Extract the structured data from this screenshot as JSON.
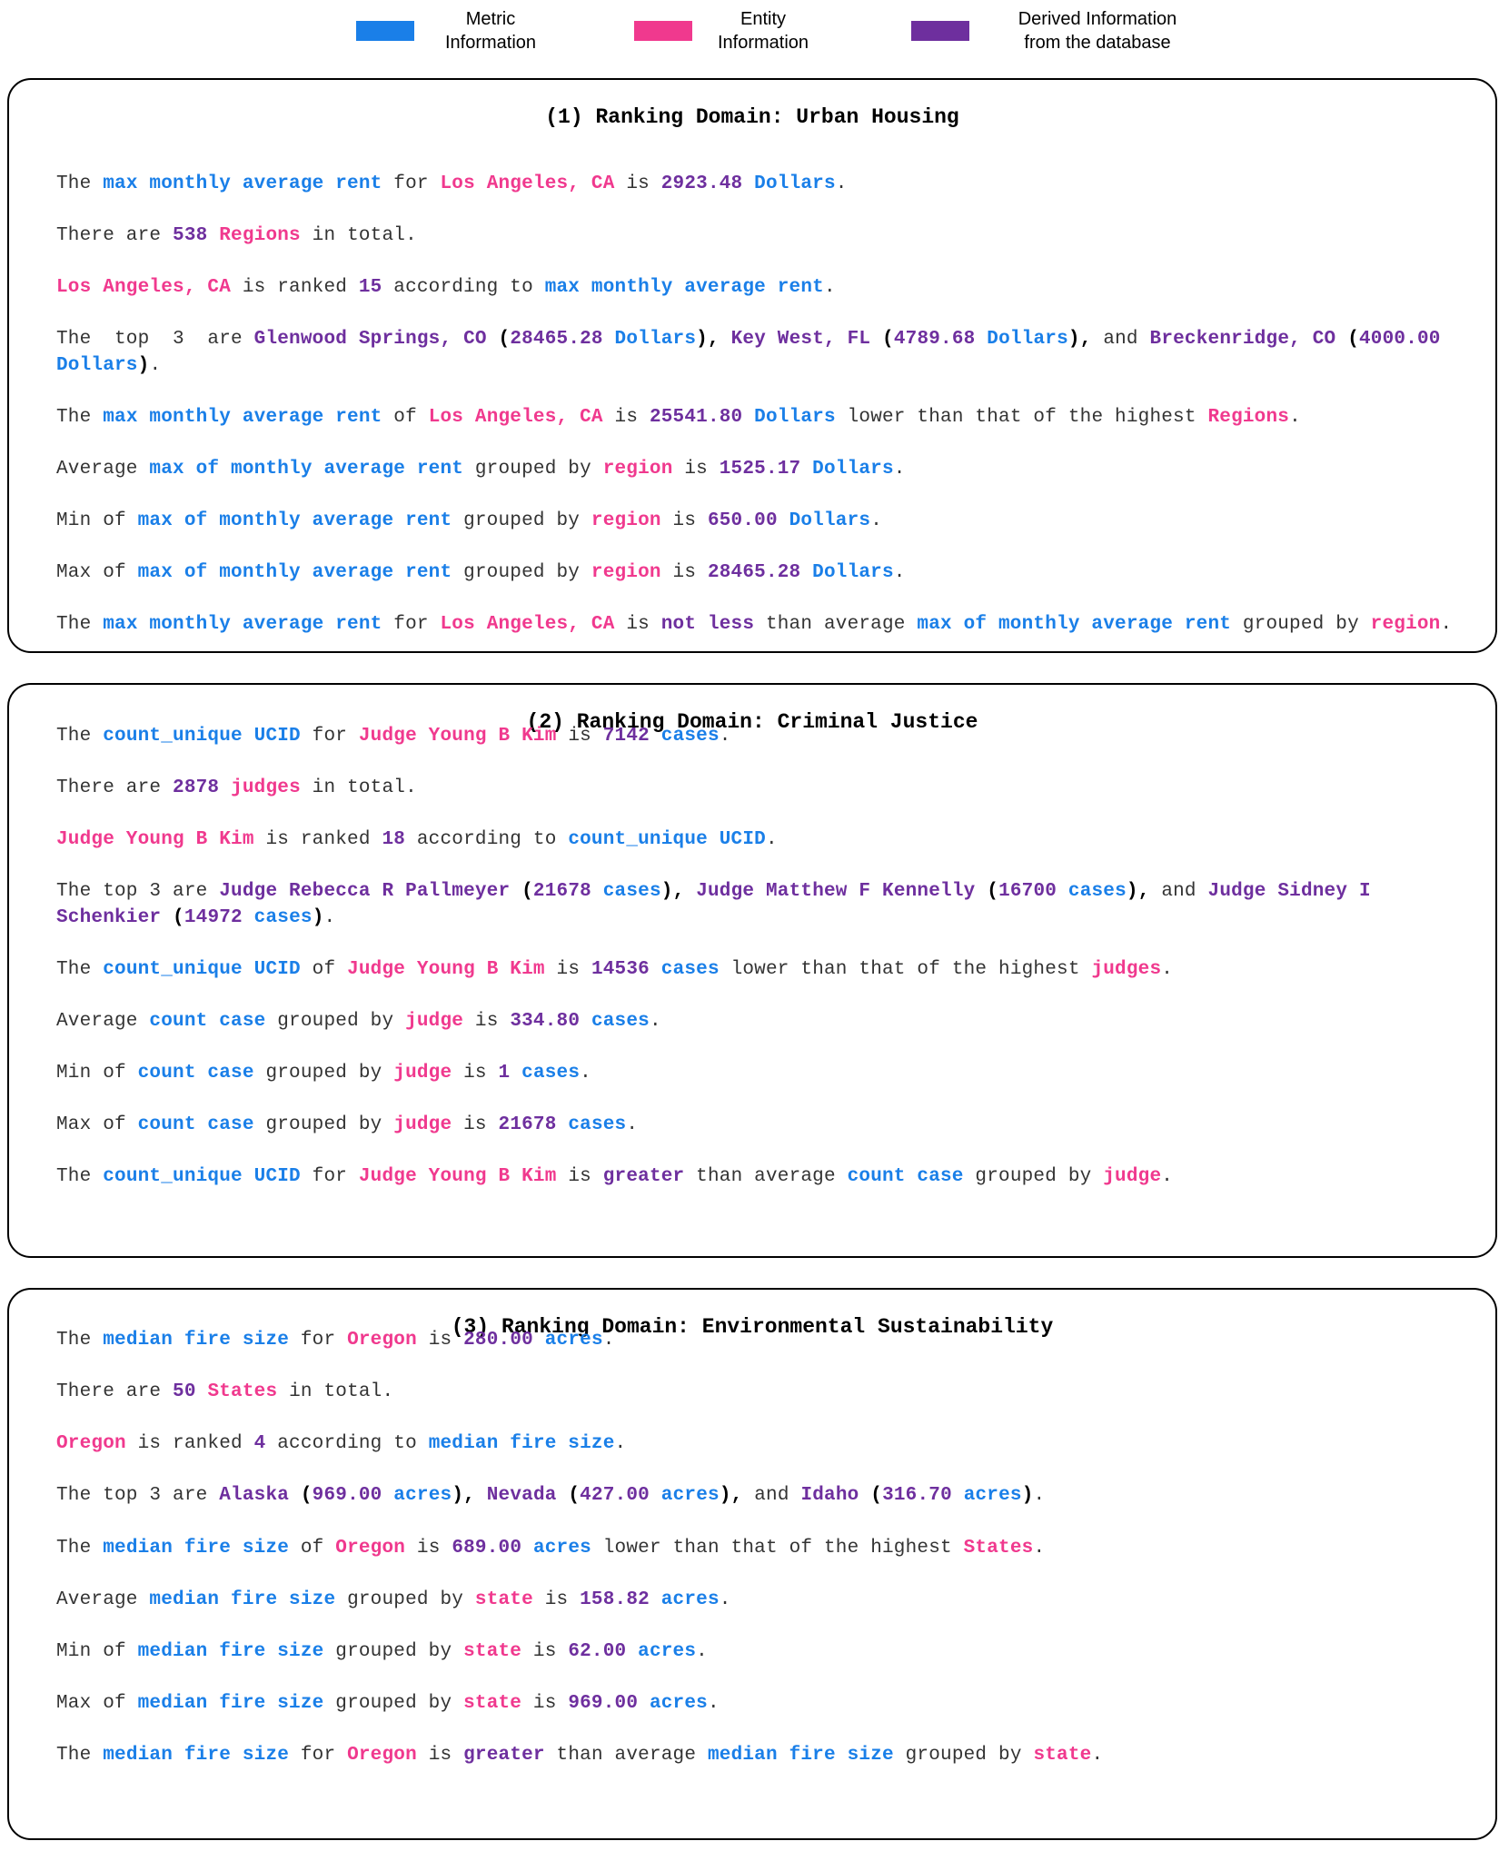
{
  "colors": {
    "metric": "#1A7FE8",
    "entity": "#F0398E",
    "derived": "#6E2F9E",
    "text": "#333333",
    "border": "#000000"
  },
  "legend": [
    {
      "label_line1": "Metric",
      "label_line2": "Information",
      "color": "#1A7FE8"
    },
    {
      "label_line1": "Entity",
      "label_line2": "Information",
      "color": "#F0398E"
    },
    {
      "label_line1": "Derived Information",
      "label_line2": "from the database",
      "color": "#6E2F9E"
    }
  ],
  "panels": [
    {
      "title": "(1) Ranking Domain: Urban Housing",
      "lines": [
        [
          [
            "t",
            "The "
          ],
          [
            "m",
            "max monthly average rent"
          ],
          [
            "t",
            " for "
          ],
          [
            "e",
            "Los Angeles, CA"
          ],
          [
            "t",
            " is "
          ],
          [
            "d",
            "2923.48"
          ],
          [
            "t",
            " "
          ],
          [
            "m",
            "Dollars"
          ],
          [
            "t",
            "."
          ]
        ],
        [
          [
            "t",
            "There are "
          ],
          [
            "d",
            "538"
          ],
          [
            "t",
            " "
          ],
          [
            "e",
            "Regions"
          ],
          [
            "t",
            " in total."
          ]
        ],
        [
          [
            "e",
            "Los Angeles, CA"
          ],
          [
            "t",
            " is ranked "
          ],
          [
            "d",
            "15"
          ],
          [
            "t",
            " according to "
          ],
          [
            "m",
            "max monthly average rent"
          ],
          [
            "t",
            "."
          ]
        ],
        [
          [
            "t",
            "The  top  3  are "
          ],
          [
            "d",
            "Glenwood Springs, CO"
          ],
          [
            "t",
            " "
          ],
          [
            "s",
            "("
          ],
          [
            "d",
            "28465.28"
          ],
          [
            "t",
            " "
          ],
          [
            "m",
            "Dollars"
          ],
          [
            "s",
            "),"
          ],
          [
            "t",
            " "
          ],
          [
            "d",
            "Key West, FL"
          ],
          [
            "t",
            " "
          ],
          [
            "s",
            "("
          ],
          [
            "d",
            "4789.68"
          ],
          [
            "t",
            " "
          ],
          [
            "m",
            "Dollars"
          ],
          [
            "s",
            "),"
          ],
          [
            "t",
            " and "
          ],
          [
            "d",
            "Breckenridge, CO"
          ],
          [
            "t",
            " "
          ],
          [
            "s",
            "("
          ],
          [
            "d",
            "4000.00"
          ],
          [
            "t",
            " "
          ],
          [
            "m",
            "Dollars"
          ],
          [
            "s",
            ")"
          ],
          [
            "t",
            "."
          ]
        ],
        [
          [
            "t",
            "The "
          ],
          [
            "m",
            "max monthly average rent"
          ],
          [
            "t",
            " of "
          ],
          [
            "e",
            "Los Angeles, CA"
          ],
          [
            "t",
            " is "
          ],
          [
            "d",
            "25541.80"
          ],
          [
            "t",
            " "
          ],
          [
            "m",
            "Dollars"
          ],
          [
            "t",
            " lower than that of the highest "
          ],
          [
            "e",
            "Regions"
          ],
          [
            "t",
            "."
          ]
        ],
        [
          [
            "t",
            "Average "
          ],
          [
            "m",
            "max of monthly average rent"
          ],
          [
            "t",
            " grouped by "
          ],
          [
            "e",
            "region"
          ],
          [
            "t",
            " is "
          ],
          [
            "d",
            "1525.17"
          ],
          [
            "t",
            " "
          ],
          [
            "m",
            "Dollars"
          ],
          [
            "t",
            "."
          ]
        ],
        [
          [
            "t",
            "Min of "
          ],
          [
            "m",
            "max of monthly average rent"
          ],
          [
            "t",
            " grouped by "
          ],
          [
            "e",
            "region"
          ],
          [
            "t",
            " is "
          ],
          [
            "d",
            "650.00"
          ],
          [
            "t",
            " "
          ],
          [
            "m",
            "Dollars"
          ],
          [
            "t",
            "."
          ]
        ],
        [
          [
            "t",
            "Max of "
          ],
          [
            "m",
            "max of monthly average rent"
          ],
          [
            "t",
            " grouped by "
          ],
          [
            "e",
            "region"
          ],
          [
            "t",
            " is "
          ],
          [
            "d",
            "28465.28"
          ],
          [
            "t",
            " "
          ],
          [
            "m",
            "Dollars"
          ],
          [
            "t",
            "."
          ]
        ],
        [
          [
            "t",
            "The "
          ],
          [
            "m",
            "max monthly average rent"
          ],
          [
            "t",
            " for "
          ],
          [
            "e",
            "Los Angeles, CA"
          ],
          [
            "t",
            " is "
          ],
          [
            "d",
            "not less"
          ],
          [
            "t",
            " than average "
          ],
          [
            "m",
            "max of monthly average rent"
          ],
          [
            "t",
            " grouped by "
          ],
          [
            "e",
            "region"
          ],
          [
            "t",
            "."
          ]
        ]
      ]
    },
    {
      "title": "(2) Ranking Domain: Criminal Justice",
      "lines": [
        [
          [
            "t",
            "The "
          ],
          [
            "m",
            "count_unique UCID"
          ],
          [
            "t",
            " for "
          ],
          [
            "e",
            "Judge Young B Kim"
          ],
          [
            "t",
            " is "
          ],
          [
            "d",
            "7142"
          ],
          [
            "t",
            " "
          ],
          [
            "m",
            "cases"
          ],
          [
            "t",
            "."
          ]
        ],
        [
          [
            "t",
            "There are "
          ],
          [
            "d",
            "2878"
          ],
          [
            "t",
            " "
          ],
          [
            "e",
            "judges"
          ],
          [
            "t",
            " in total."
          ]
        ],
        [
          [
            "e",
            "Judge Young B Kim"
          ],
          [
            "t",
            " is ranked "
          ],
          [
            "d",
            "18"
          ],
          [
            "t",
            " according to "
          ],
          [
            "m",
            "count_unique UCID"
          ],
          [
            "t",
            "."
          ]
        ],
        [
          [
            "t",
            "The top 3 are "
          ],
          [
            "d",
            "Judge Rebecca R Pallmeyer"
          ],
          [
            "t",
            " "
          ],
          [
            "s",
            "("
          ],
          [
            "d",
            "21678"
          ],
          [
            "t",
            " "
          ],
          [
            "m",
            "cases"
          ],
          [
            "s",
            "),"
          ],
          [
            "t",
            " "
          ],
          [
            "d",
            "Judge Matthew F Kennelly"
          ],
          [
            "t",
            " "
          ],
          [
            "s",
            "("
          ],
          [
            "d",
            "16700"
          ],
          [
            "t",
            " "
          ],
          [
            "m",
            "cases"
          ],
          [
            "s",
            "),"
          ],
          [
            "t",
            " and "
          ],
          [
            "d",
            "Judge Sidney I Schenkier"
          ],
          [
            "t",
            " "
          ],
          [
            "s",
            "("
          ],
          [
            "d",
            "14972"
          ],
          [
            "t",
            " "
          ],
          [
            "m",
            "cases"
          ],
          [
            "s",
            ")"
          ],
          [
            "t",
            "."
          ]
        ],
        [
          [
            "t",
            "The "
          ],
          [
            "m",
            "count_unique UCID"
          ],
          [
            "t",
            " of "
          ],
          [
            "e",
            "Judge Young B Kim"
          ],
          [
            "t",
            " is "
          ],
          [
            "d",
            "14536"
          ],
          [
            "t",
            " "
          ],
          [
            "m",
            "cases"
          ],
          [
            "t",
            " lower than that of the highest "
          ],
          [
            "e",
            "judges"
          ],
          [
            "t",
            "."
          ]
        ],
        [
          [
            "t",
            "Average "
          ],
          [
            "m",
            "count case"
          ],
          [
            "t",
            " grouped by "
          ],
          [
            "e",
            "judge"
          ],
          [
            "t",
            " is "
          ],
          [
            "d",
            "334.80"
          ],
          [
            "t",
            " "
          ],
          [
            "m",
            "cases"
          ],
          [
            "t",
            "."
          ]
        ],
        [
          [
            "t",
            "Min of "
          ],
          [
            "m",
            "count case"
          ],
          [
            "t",
            " grouped by "
          ],
          [
            "e",
            "judge"
          ],
          [
            "t",
            " is "
          ],
          [
            "d",
            "1"
          ],
          [
            "t",
            " "
          ],
          [
            "m",
            "cases"
          ],
          [
            "t",
            "."
          ]
        ],
        [
          [
            "t",
            "Max of "
          ],
          [
            "m",
            "count case"
          ],
          [
            "t",
            " grouped by "
          ],
          [
            "e",
            "judge"
          ],
          [
            "t",
            " is "
          ],
          [
            "d",
            "21678"
          ],
          [
            "t",
            " "
          ],
          [
            "m",
            "cases"
          ],
          [
            "t",
            "."
          ]
        ],
        [
          [
            "t",
            "The "
          ],
          [
            "m",
            "count_unique UCID"
          ],
          [
            "t",
            " for "
          ],
          [
            "e",
            "Judge Young B Kim"
          ],
          [
            "t",
            " is "
          ],
          [
            "d",
            "greater"
          ],
          [
            "t",
            " than average "
          ],
          [
            "m",
            "count case"
          ],
          [
            "t",
            " grouped by "
          ],
          [
            "e",
            "judge"
          ],
          [
            "t",
            "."
          ]
        ]
      ]
    },
    {
      "title": "(3) Ranking Domain: Environmental Sustainability",
      "lines": [
        [
          [
            "t",
            "The "
          ],
          [
            "m",
            "median fire size"
          ],
          [
            "t",
            " for "
          ],
          [
            "e",
            "Oregon"
          ],
          [
            "t",
            " is "
          ],
          [
            "d",
            "280.00"
          ],
          [
            "t",
            " "
          ],
          [
            "m",
            "acres"
          ],
          [
            "t",
            "."
          ]
        ],
        [
          [
            "t",
            "There are "
          ],
          [
            "d",
            "50"
          ],
          [
            "t",
            " "
          ],
          [
            "e",
            "States"
          ],
          [
            "t",
            " in total."
          ]
        ],
        [
          [
            "e",
            "Oregon"
          ],
          [
            "t",
            " is ranked "
          ],
          [
            "d",
            "4"
          ],
          [
            "t",
            " according to "
          ],
          [
            "m",
            "median fire size"
          ],
          [
            "t",
            "."
          ]
        ],
        [
          [
            "t",
            "The top 3 are "
          ],
          [
            "d",
            "Alaska"
          ],
          [
            "t",
            " "
          ],
          [
            "s",
            "("
          ],
          [
            "d",
            "969.00"
          ],
          [
            "t",
            " "
          ],
          [
            "m",
            "acres"
          ],
          [
            "s",
            "),"
          ],
          [
            "t",
            " "
          ],
          [
            "d",
            "Nevada"
          ],
          [
            "t",
            " "
          ],
          [
            "s",
            "("
          ],
          [
            "d",
            "427.00"
          ],
          [
            "t",
            " "
          ],
          [
            "m",
            "acres"
          ],
          [
            "s",
            "),"
          ],
          [
            "t",
            " and "
          ],
          [
            "d",
            "Idaho"
          ],
          [
            "t",
            " "
          ],
          [
            "s",
            "("
          ],
          [
            "d",
            "316.70"
          ],
          [
            "t",
            " "
          ],
          [
            "m",
            "acres"
          ],
          [
            "s",
            ")"
          ],
          [
            "t",
            "."
          ]
        ],
        [
          [
            "t",
            "The "
          ],
          [
            "m",
            "median fire size"
          ],
          [
            "t",
            " of "
          ],
          [
            "e",
            "Oregon"
          ],
          [
            "t",
            " is "
          ],
          [
            "d",
            "689.00"
          ],
          [
            "t",
            " "
          ],
          [
            "m",
            "acres"
          ],
          [
            "t",
            " lower than that of the highest "
          ],
          [
            "e",
            "States"
          ],
          [
            "t",
            "."
          ]
        ],
        [
          [
            "t",
            "Average "
          ],
          [
            "m",
            "median fire size"
          ],
          [
            "t",
            " grouped by "
          ],
          [
            "e",
            "state"
          ],
          [
            "t",
            " is "
          ],
          [
            "d",
            "158.82"
          ],
          [
            "t",
            " "
          ],
          [
            "m",
            "acres"
          ],
          [
            "t",
            "."
          ]
        ],
        [
          [
            "t",
            "Min of "
          ],
          [
            "m",
            "median fire size"
          ],
          [
            "t",
            " grouped by "
          ],
          [
            "e",
            "state"
          ],
          [
            "t",
            " is "
          ],
          [
            "d",
            "62.00"
          ],
          [
            "t",
            " "
          ],
          [
            "m",
            "acres"
          ],
          [
            "t",
            "."
          ]
        ],
        [
          [
            "t",
            "Max of "
          ],
          [
            "m",
            "median fire size"
          ],
          [
            "t",
            " grouped by "
          ],
          [
            "e",
            "state"
          ],
          [
            "t",
            " is "
          ],
          [
            "d",
            "969.00"
          ],
          [
            "t",
            " "
          ],
          [
            "m",
            "acres"
          ],
          [
            "t",
            "."
          ]
        ],
        [
          [
            "t",
            "The "
          ],
          [
            "m",
            "median fire size"
          ],
          [
            "t",
            " for "
          ],
          [
            "e",
            "Oregon"
          ],
          [
            "t",
            " is "
          ],
          [
            "d",
            "greater"
          ],
          [
            "t",
            " than average "
          ],
          [
            "m",
            "median fire size"
          ],
          [
            "t",
            " grouped by "
          ],
          [
            "e",
            "state"
          ],
          [
            "t",
            "."
          ]
        ]
      ]
    }
  ]
}
